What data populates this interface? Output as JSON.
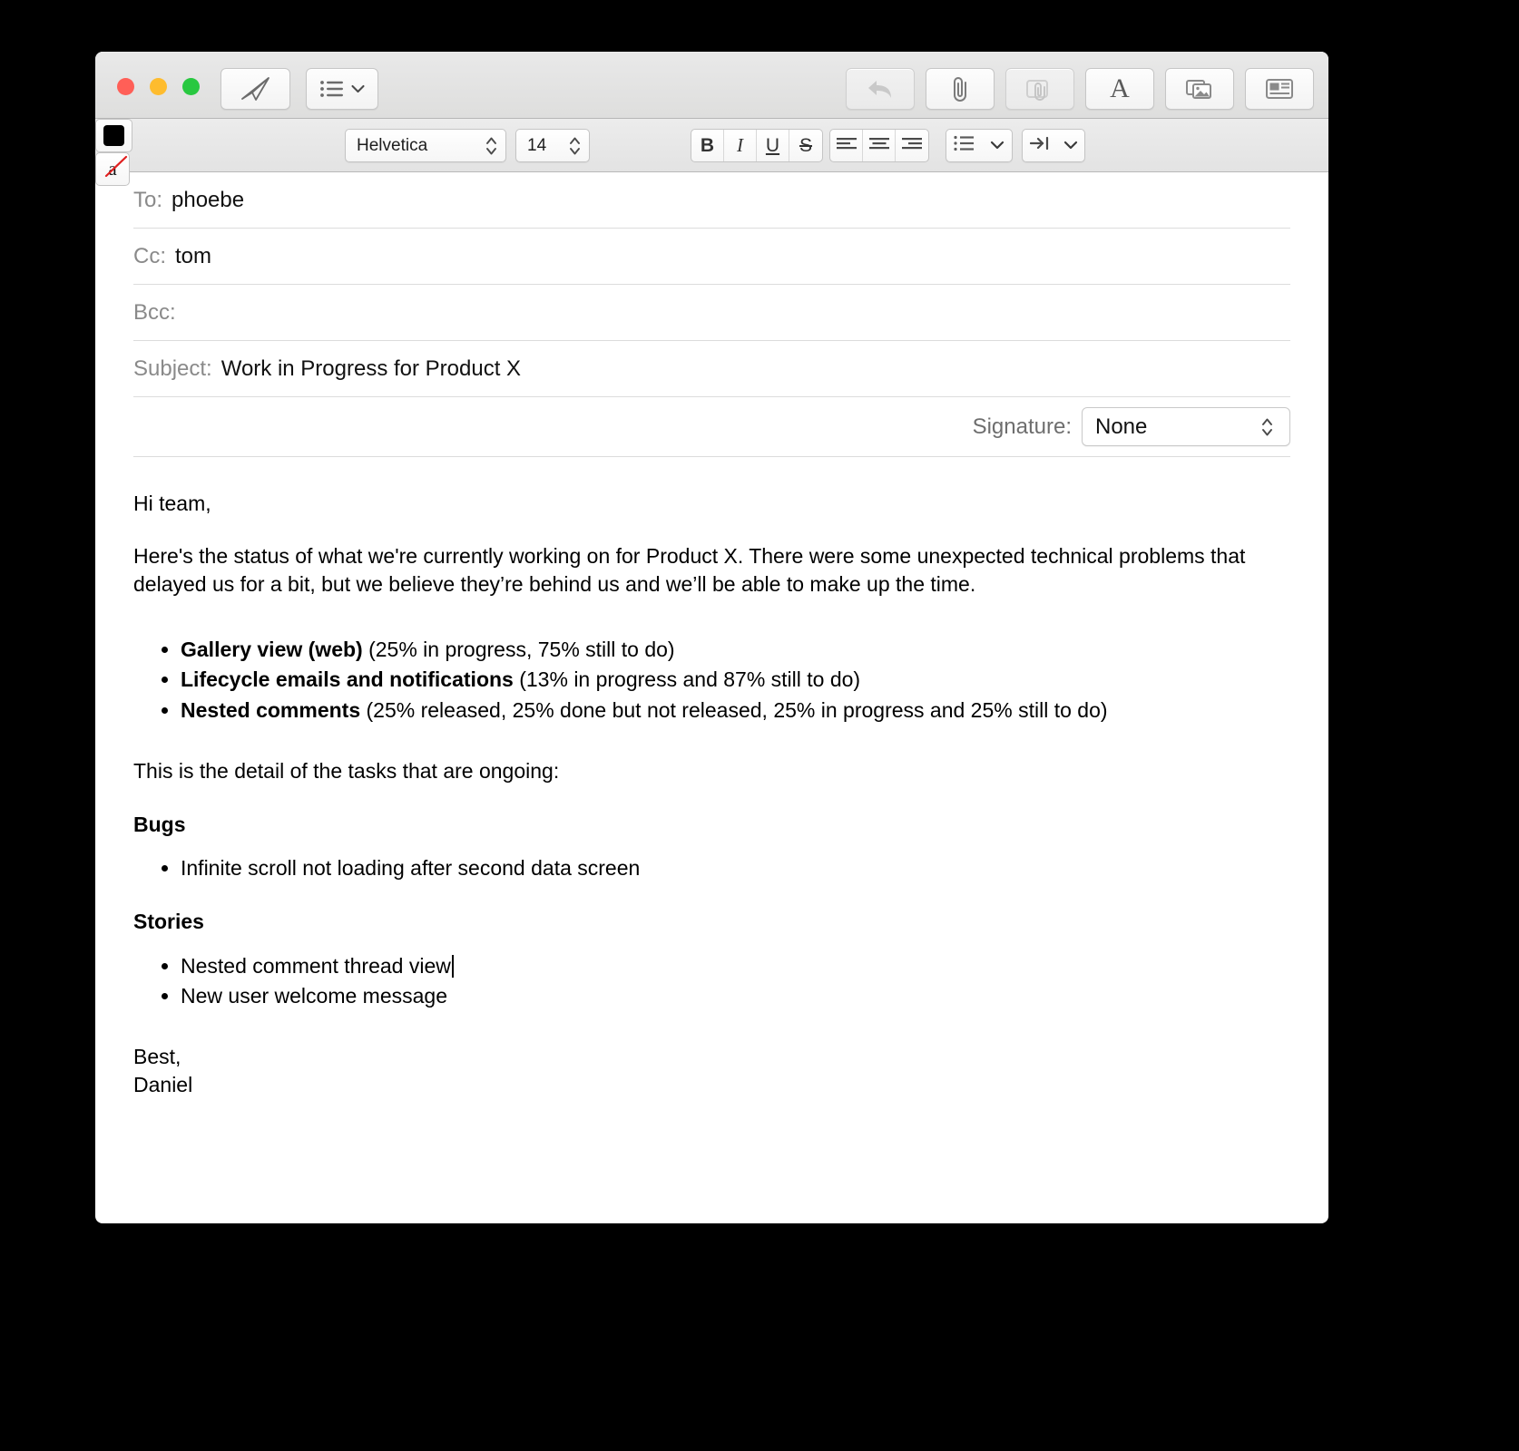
{
  "window": {
    "traffic_lights": [
      "close",
      "minimize",
      "zoom"
    ],
    "colors": {
      "close": "#ff5f57",
      "minimize": "#febc2e",
      "zoom": "#28c840",
      "text_color_well": "#000000"
    }
  },
  "toolbar": {
    "send_label": "send-icon",
    "header_fields_label": "list-icon",
    "reply_label": "reply-icon",
    "attach_label": "paperclip-icon",
    "markup_label": "markup-icon",
    "fonts_label": "A",
    "photos_label": "photo-browser-icon",
    "stationery_label": "stationery-icon"
  },
  "format_bar": {
    "font_family": "Helvetica",
    "font_size": "14",
    "text_color": "#000000",
    "clear_formatting_label": "a",
    "bold_label": "B",
    "italic_label": "I",
    "underline_label": "U",
    "strikethrough_label": "S",
    "align_left_label": "align-left-icon",
    "align_center_label": "align-center-icon",
    "align_right_label": "align-right-icon",
    "list_label": "list-icon",
    "indent_label": "indent-icon"
  },
  "headers": {
    "to": {
      "label": "To:",
      "value": "phoebe"
    },
    "cc": {
      "label": "Cc:",
      "value": "tom"
    },
    "bcc": {
      "label": "Bcc:",
      "value": ""
    },
    "subject": {
      "label": "Subject:",
      "value": "Work in Progress for Product X"
    },
    "signature": {
      "label": "Signature:",
      "value": "None"
    }
  },
  "body": {
    "greeting": "Hi team,",
    "intro": "Here's the status of what we're currently working on for Product X. There were some unexpected technical problems that delayed us for a bit, but we believe they’re behind us and we’ll be able to make up the time.",
    "status_items": [
      {
        "title": "Gallery view (web)",
        "detail": "(25% in progress, 75% still to do)"
      },
      {
        "title": "Lifecycle emails and notifications",
        "detail": "(13% in progress and 87% still to do)"
      },
      {
        "title": "Nested comments",
        "detail": "(25% released, 25% done but not released, 25% in progress and 25% still to do)"
      }
    ],
    "detail_intro": "This is the detail of the tasks that are ongoing:",
    "sections": [
      {
        "heading": "Bugs",
        "items": [
          "Infinite scroll not loading after second data screen"
        ]
      },
      {
        "heading": "Stories",
        "items": [
          "Nested comment thread view",
          "New user welcome message"
        ]
      }
    ],
    "signoff_1": "Best,",
    "signoff_2": "Daniel"
  }
}
